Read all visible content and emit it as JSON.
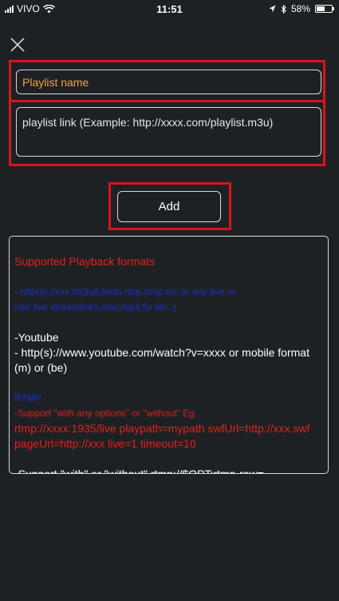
{
  "status_bar": {
    "carrier": "VIVO",
    "time": "11:51",
    "battery_percent": "58%",
    "battery_level": 0.58
  },
  "form": {
    "playlist_name_placeholder": "Playlist name",
    "playlist_link_placeholder": "playlist link (Example: http://xxxx.com/playlist.m3u)",
    "add_label": "Add"
  },
  "formats": {
    "heading": "Supported Playback formats",
    "blurred_line_1": "- http(s)://xxx.tht3u8,hmts,rtsp,rtmp etc or any live or",
    "blurred_line_2": "non live streamlinks,mov,mp4,flv etc..)",
    "youtube_title": "-Youtube",
    "youtube_desc": "- http(s)://www.youtube.com/watch?v=xxxx or mobile format (m) or (be)",
    "rtmp_title": "RTMP",
    "rtmp_blurred": "-Support \"with any options\" or \"without\" Eg.",
    "rtmp_example": "rtmp://xxxx:1935/live playpath=mypath swfUrl=http://xxx.swf pageUrl=http://xxx live=1 timeout=10",
    "support_line": "-Support \"with\" or \"without\" rtmp://$OPT:rtmp-raw="
  },
  "colors": {
    "background": "#1e2124",
    "highlight_red": "#d8141c",
    "placeholder_orange": "#f0a04b",
    "link_blue": "#1a2fd6"
  }
}
